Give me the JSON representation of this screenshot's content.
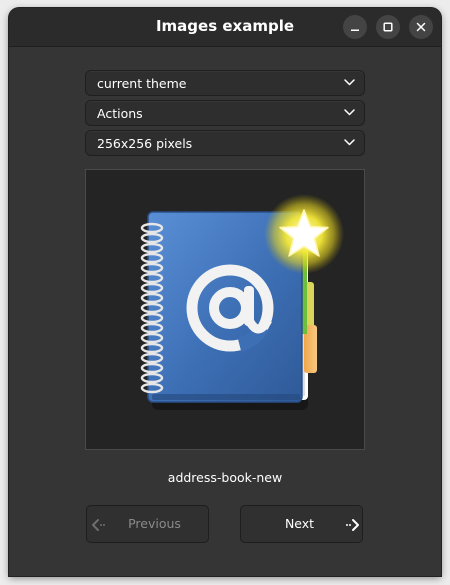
{
  "window": {
    "title": "Images example"
  },
  "titlebar_buttons": [
    {
      "name": "minimize",
      "icon": "minimize-icon"
    },
    {
      "name": "maximize",
      "icon": "maximize-icon"
    },
    {
      "name": "close",
      "icon": "close-icon"
    }
  ],
  "selectors": {
    "theme": "current theme",
    "context": "Actions",
    "size": "256x256 pixels"
  },
  "preview": {
    "icon": "address-book-new-icon",
    "icon_name": "address-book-new"
  },
  "navigation": {
    "previous_label": "Previous",
    "next_label": "Next"
  },
  "colors": {
    "window_bg": "#353535",
    "titlebar_bg": "#2b2b2b",
    "book_blue": "#3d6fb5",
    "star_yellow": "#f5e533"
  }
}
